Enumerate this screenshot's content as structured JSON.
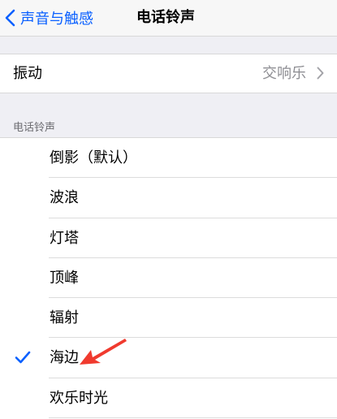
{
  "nav": {
    "back_label": "声音与触感",
    "title": "电话铃声"
  },
  "vibration": {
    "label": "振动",
    "value": "交响乐"
  },
  "ringtones": {
    "section_header": "电话铃声",
    "items": [
      {
        "label": "倒影（默认）",
        "selected": false
      },
      {
        "label": "波浪",
        "selected": false
      },
      {
        "label": "灯塔",
        "selected": false
      },
      {
        "label": "顶峰",
        "selected": false
      },
      {
        "label": "辐射",
        "selected": false
      },
      {
        "label": "海边",
        "selected": true
      },
      {
        "label": "欢乐时光",
        "selected": false
      }
    ]
  },
  "colors": {
    "accent": "#0a60ff",
    "annotation_arrow": "#f03a2e",
    "group_background": "#efeff4"
  },
  "icons": {
    "back": "chevron-left-icon",
    "disclosure": "chevron-right-icon",
    "selected": "checkmark-icon"
  }
}
